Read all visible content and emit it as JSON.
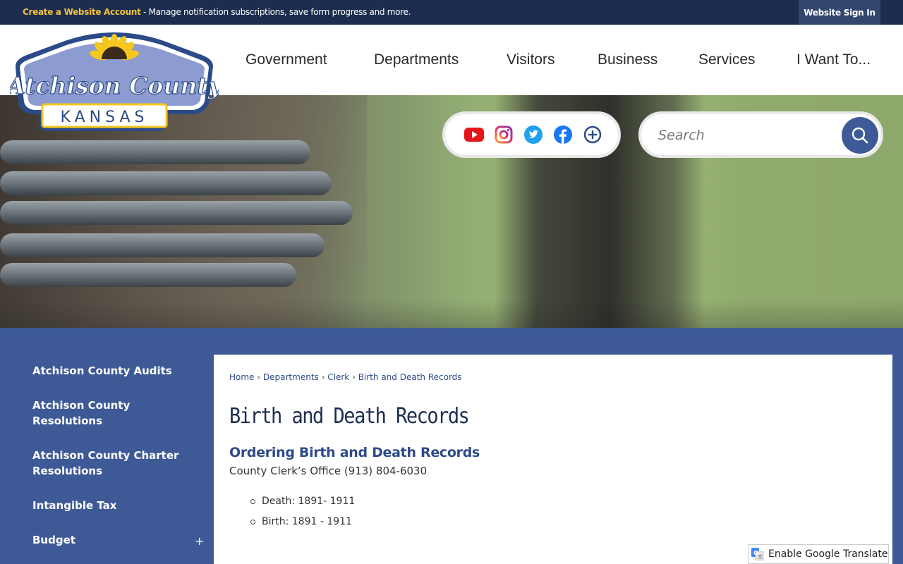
{
  "topbar": {
    "link_label": "Create a Website Account",
    "message": " - Manage notification subscriptions, save form progress and more.",
    "signin_label": "Website Sign In"
  },
  "logo": {
    "line1": "Atchison County",
    "line2": "KANSAS"
  },
  "nav": {
    "items": [
      "Government",
      "Departments",
      "Visitors",
      "Business",
      "Services",
      "I Want To..."
    ]
  },
  "social": {
    "icons": [
      "youtube-icon",
      "instagram-icon",
      "twitter-icon",
      "facebook-icon",
      "more-icon"
    ]
  },
  "search": {
    "placeholder": "Search"
  },
  "sidebar": {
    "items": [
      "Atchison County Audits",
      "Atchison County Resolutions",
      "Atchison County Charter Resolutions",
      "Intangible Tax",
      "Budget"
    ],
    "expand_glyph": "+"
  },
  "breadcrumb": {
    "home": "Home",
    "departments": "Departments",
    "clerk": "Clerk",
    "current": "Birth and Death Records",
    "separator": "›"
  },
  "main": {
    "title": "Birth and Death Records",
    "subtitle": "Ordering Birth and Death Records",
    "contact": "County Clerk’s Office (913) 804-6030",
    "records": [
      "Death: 1891- 1911",
      "Birth: 1891 - 1911"
    ]
  },
  "translate": {
    "label": "Enable Google Translate"
  },
  "colors": {
    "navy": "#1d2d4f",
    "brand_blue": "#3e5a96",
    "link_yellow": "#f2c23c",
    "link_blue": "#2e4a88"
  }
}
